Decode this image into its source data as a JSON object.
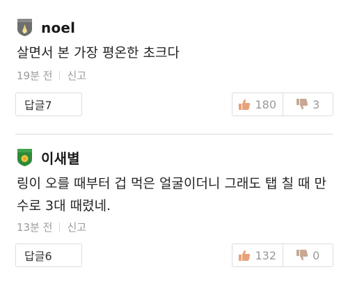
{
  "comments": [
    {
      "nickname": "noel",
      "body": "살면서 본 가장 평온한 초크다",
      "time": "19분 전",
      "report": "신고",
      "reply": "답글7",
      "likes": "180",
      "dislikes": "3",
      "badge_color": "#6e6e6e"
    },
    {
      "nickname": "이새별",
      "body": "링이 오를 때부터 겁 먹은 얼굴이더니 그래도 탭 칠 때 만수로 3대 때렸네.",
      "time": "13분 전",
      "report": "신고",
      "reply": "답글6",
      "likes": "132",
      "dislikes": "0",
      "badge_color": "#2e8b3a"
    }
  ],
  "colors": {
    "like": "#e8a27a",
    "dislike": "#c6a894",
    "muted": "#9a9a9a"
  }
}
